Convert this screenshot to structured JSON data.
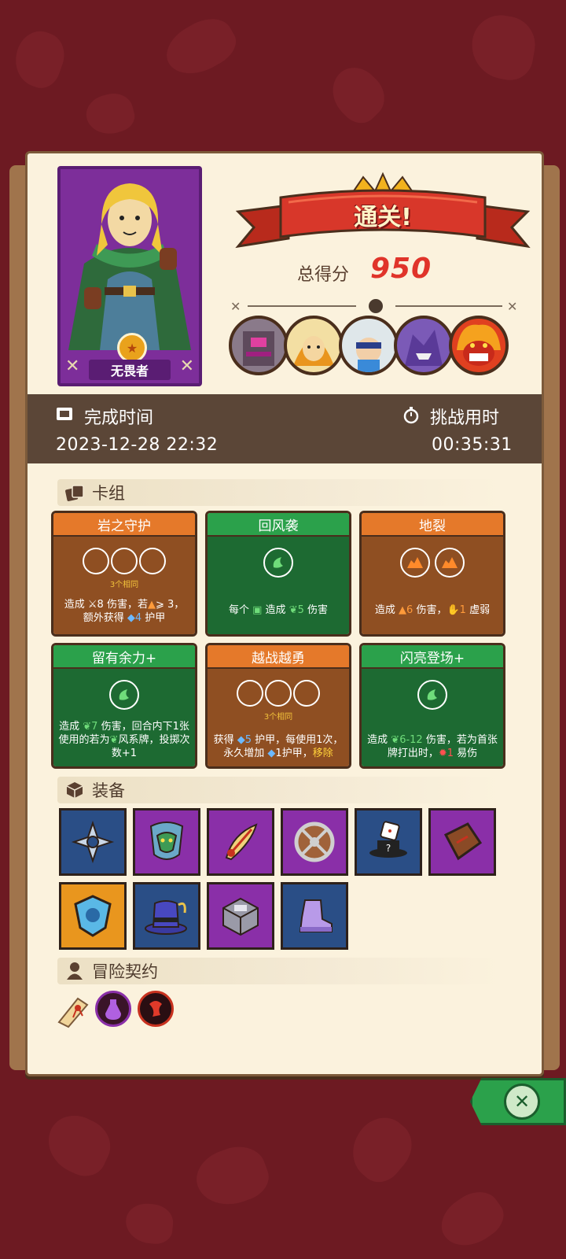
{
  "hero": {
    "name": "无畏者"
  },
  "result": {
    "banner": "通关!",
    "score_label": "总得分",
    "score_value": "950"
  },
  "time": {
    "finish_label": "完成时间",
    "finish_value": "2023-12-28 22:32",
    "duration_label": "挑战用时",
    "duration_value": "00:35:31"
  },
  "sections": {
    "deck": "卡组",
    "equipment": "装备",
    "contracts": "冒险契约"
  },
  "cards": [
    {
      "name": "岩之守护",
      "color": "orange",
      "dice": 3,
      "same": "3个相同"
    },
    {
      "name": "回风袭",
      "color": "green"
    },
    {
      "name": "地裂",
      "color": "orange"
    },
    {
      "name": "留有余力+",
      "color": "green"
    },
    {
      "name": "越战越勇",
      "color": "orange",
      "dice": 3,
      "same": "3个相同"
    },
    {
      "name": "闪亮登场+",
      "color": "green"
    }
  ],
  "card_text": {
    "c0_a": "造成 ",
    "c0_b": "8",
    "c0_c": " 伤害，若",
    "c0_d": "⩾ 3，",
    "c0_e": "额外获得 ",
    "c0_f": "4",
    "c0_g": " 护甲",
    "c1_a": "每个 ",
    "c1_b": " 造成 ",
    "c1_c": "5",
    "c1_d": " 伤害",
    "c2_a": "造成 ",
    "c2_b": "6",
    "c2_c": " 伤害，",
    "c2_d": "1",
    "c2_e": " 虚弱",
    "c3_a": "造成 ",
    "c3_b": "7",
    "c3_c": " 伤害，回合内下1张使用的若为",
    "c3_d": "风系牌，投掷次数+1",
    "c4_a": "获得 ",
    "c4_b": "5",
    "c4_c": " 护甲，每使用1次，永久增加 ",
    "c4_d": "1",
    "c4_e": "护甲，",
    "c4_f": "移除",
    "c5_a": "造成 ",
    "c5_b": "6-12",
    "c5_c": " 伤害，若为首张牌打出时，",
    "c5_d": "1",
    "c5_e": " 易伤"
  },
  "equipment": [
    {
      "icon": "shuriken-icon",
      "color": "blue"
    },
    {
      "icon": "demon-mask-icon",
      "color": "purple"
    },
    {
      "icon": "feather-scroll-icon",
      "color": "purple"
    },
    {
      "icon": "round-shield-icon",
      "color": "purple"
    },
    {
      "icon": "magic-hat-dice-icon",
      "color": "blue"
    },
    {
      "icon": "wooden-board-icon",
      "color": "purple"
    },
    {
      "icon": "crystal-shield-icon",
      "color": "orange"
    },
    {
      "icon": "top-hat-icon",
      "color": "blue"
    },
    {
      "icon": "metal-cube-icon",
      "color": "purple"
    },
    {
      "icon": "purple-boot-icon",
      "color": "blue"
    }
  ],
  "equip_unknown_mark": "?",
  "contracts": [
    {
      "icon": "scroll-icon"
    },
    {
      "icon": "purple-potion-token-icon"
    },
    {
      "icon": "red-rune-token-icon"
    }
  ],
  "close_symbol": "✕",
  "colors": {
    "background": "#6d1a22",
    "panel": "#fbf2dd",
    "score": "#e0342a",
    "banner": "#c8321f"
  }
}
